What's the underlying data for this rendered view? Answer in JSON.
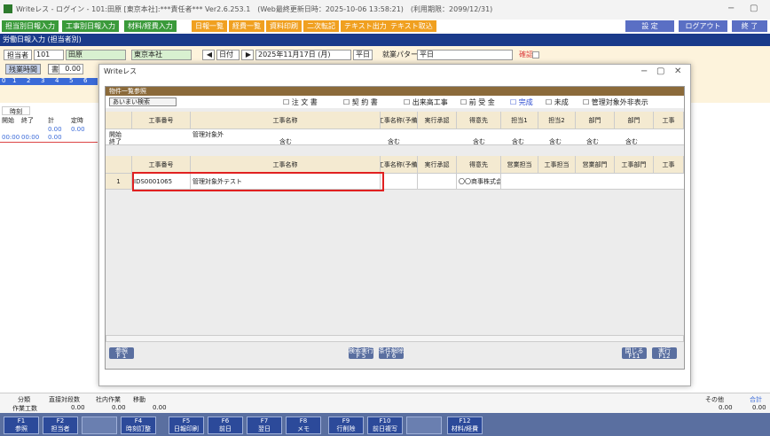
{
  "window": {
    "title": "Writeレス - ログイン - 101:田原 [東京本社]:***責任者*** Ver2.6.253.1　(Web最終更新日時：2025-10-06 13:58:21)　(利用期限：2099/12/31)",
    "min": "−",
    "max": "▢"
  },
  "menu": {
    "items": [
      "担当別日報入力",
      "工事別日報入力",
      "材料/経費入力",
      "日報一覧",
      "経費一覧",
      "資料印刷",
      "二次転記",
      "テキスト出力",
      "テキスト取込"
    ],
    "settings": "設 定",
    "logout": "ログアウト",
    "exit": "終 了"
  },
  "header_band": "労働日報入力 (担当者別)",
  "form": {
    "tanto_label": "担当者",
    "tanto_code": "101",
    "tanto_name": "田原",
    "office": "東京本社",
    "date_label": "日付",
    "date_value": "2025年11月17日 (月)",
    "weekday_type": "平日",
    "pattern_label": "就業パターン",
    "pattern_value": "平日",
    "confirm_label": "確認",
    "overtime_label": "残業時間",
    "overtime_hours": "0.00",
    "overtime_btn": "書"
  },
  "timeline": {
    "nums": [
      "0",
      "1",
      "2",
      "3",
      "4",
      "5",
      "6"
    ]
  },
  "left_table": {
    "title": "時刻",
    "headers": [
      "開始",
      "終了",
      "計",
      "定時"
    ],
    "totals": [
      "0.00",
      "0.00"
    ],
    "row": [
      "00:00",
      "00:00",
      "0.00"
    ]
  },
  "modal": {
    "window_title": "Writeレス",
    "panel_title": "物件一覧参照",
    "fuzzy_search": "あいまい検索",
    "checkboxes": [
      "注 文 書",
      "契 約 書",
      "出来高工事",
      "前 受 金",
      "完成",
      "未成",
      "管理対象外非表示"
    ],
    "filter_headers": [
      "工事番号",
      "工事名称",
      "工事名称(予備)",
      "実行承認",
      "得意先",
      "担当1",
      "担当2",
      "部門",
      "部門",
      "工事"
    ],
    "filter_start_label": "開始",
    "filter_end_label": "終了",
    "filter_start_name": "管理対象外",
    "contains": "含む",
    "grid_headers": [
      "工事番号",
      "工事名称",
      "工事名称(予備)",
      "実行承認",
      "得意先",
      "営業担当",
      "工事担当",
      "営業部門",
      "工事部門",
      "工事"
    ],
    "rows": [
      {
        "num": "1",
        "code": "IDS0001065",
        "name": "管理対象外テスト",
        "customer": "〇〇商事株式会"
      }
    ],
    "btn_ref": "参照",
    "btn_ref_key": "F 1",
    "btn_search": "検索実行",
    "btn_search_key": "F 5",
    "btn_clear": "条件解除",
    "btn_clear_key": "F 6",
    "btn_close": "閉じる",
    "btn_close_key": "F11",
    "btn_exec": "実行",
    "btn_exec_key": "F12"
  },
  "summary": {
    "headers": [
      "分類",
      "直接対段数",
      "社内作業",
      "移動"
    ],
    "row_label": "作業工数",
    "values": [
      "0.00",
      "0.00",
      "0.00"
    ],
    "other_label": "その他",
    "other_value": "0.00",
    "total_label": "合計",
    "total_value": "0.00"
  },
  "fkeys": [
    [
      "F1",
      "参照"
    ],
    [
      "F2",
      "担当者"
    ],
    [
      "",
      ""
    ],
    [
      "F4",
      "時刻訂整"
    ],
    [
      "F5",
      "日報印刷"
    ],
    [
      "F6",
      "前日"
    ],
    [
      "F7",
      "翌日"
    ],
    [
      "F8",
      "メモ"
    ],
    [
      "F9",
      "行削除"
    ],
    [
      "F10",
      "前日複写"
    ],
    [
      "",
      ""
    ],
    [
      "F12",
      "材料/経費"
    ]
  ]
}
